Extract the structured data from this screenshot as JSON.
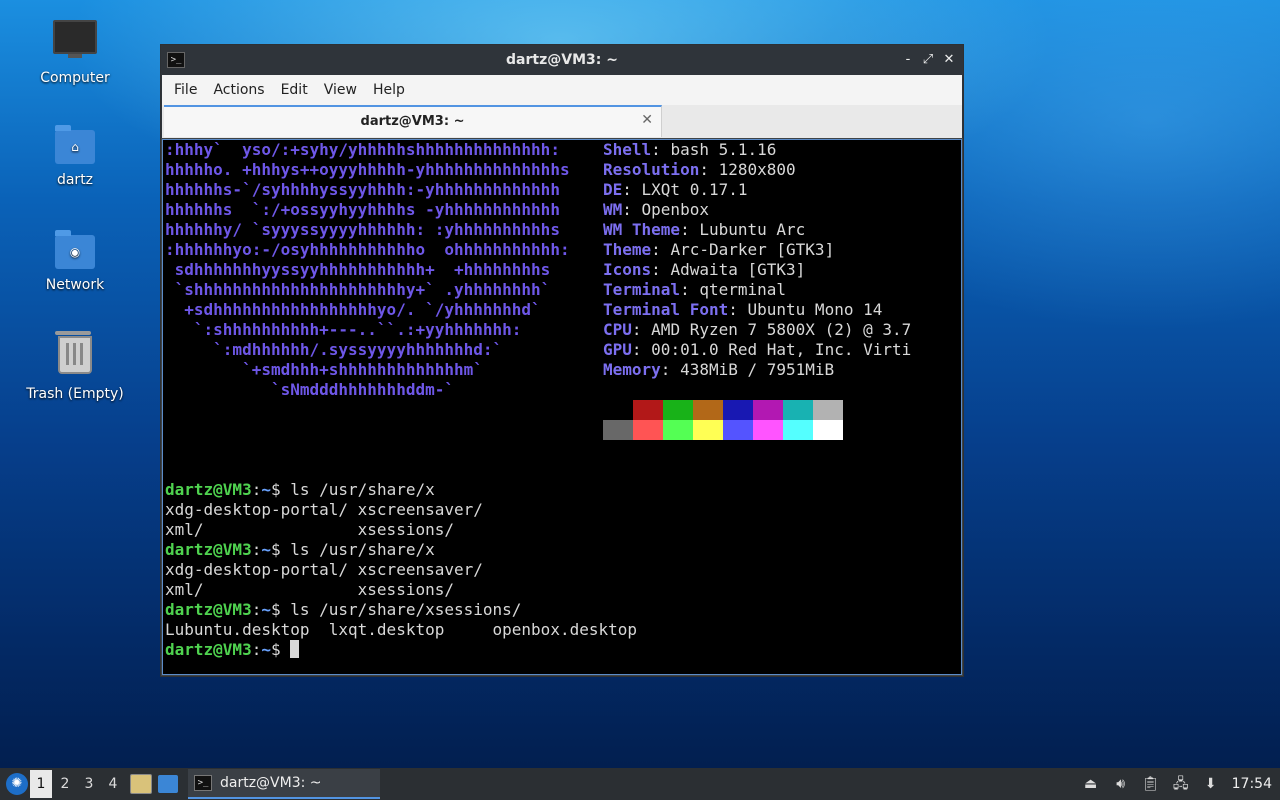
{
  "desktop": {
    "icons": [
      {
        "label": "Computer",
        "icon": "computer-icon"
      },
      {
        "label": "dartz",
        "icon": "home-folder-icon"
      },
      {
        "label": "Network",
        "icon": "network-folder-icon"
      },
      {
        "label": "Trash (Empty)",
        "icon": "trash-icon"
      }
    ]
  },
  "window": {
    "title": "dartz@VM3: ~",
    "menu": [
      "File",
      "Actions",
      "Edit",
      "View",
      "Help"
    ],
    "tab_title": "dartz@VM3: ~",
    "buttons": {
      "minimize": "‑",
      "maximize": "⤢",
      "close": "✕"
    }
  },
  "terminal": {
    "logo_lines": [
      ":hhhy`  yso/:+syhy/yhhhhhshhhhhhhhhhhhhh:",
      "hhhhho. +hhhys++oyyyhhhhh-yhhhhhhhhhhhhhhs",
      "hhhhhhs-`/syhhhhyssyyhhhh:-yhhhhhhhhhhhhh",
      "hhhhhhs  `:/+ossyyhyyhhhhs -yhhhhhhhhhhhh",
      "hhhhhhy/ `syyyssyyyyhhhhhh: :yhhhhhhhhhhs",
      ":hhhhhhyo:-/osyhhhhhhhhhhho  ohhhhhhhhhhh:",
      " sdhhhhhhhyyssyyhhhhhhhhhhh+  +hhhhhhhhs",
      " `shhhhhhhhhhhhhhhhhhhhhhy+` .yhhhhhhhh`",
      "  +sdhhhhhhhhhhhhhhhhhyo/. `/yhhhhhhhd`",
      "   `:shhhhhhhhhh+---..``.:+yyhhhhhhh:",
      "     `:mdhhhhhh/.syssyyyyhhhhhhhd:`",
      "        `+smdhhh+shhhhhhhhhhhhhm`",
      "           `sNmdddhhhhhhhddm-`"
    ],
    "info": [
      {
        "key": "Shell",
        "value": "bash 5.1.16"
      },
      {
        "key": "Resolution",
        "value": "1280x800"
      },
      {
        "key": "DE",
        "value": "LXQt 0.17.1"
      },
      {
        "key": "WM",
        "value": "Openbox"
      },
      {
        "key": "WM Theme",
        "value": "Lubuntu Arc"
      },
      {
        "key": "Theme",
        "value": "Arc-Darker [GTK3]"
      },
      {
        "key": "Icons",
        "value": "Adwaita [GTK3]"
      },
      {
        "key": "Terminal",
        "value": "qterminal"
      },
      {
        "key": "Terminal Font",
        "value": "Ubuntu Mono 14"
      },
      {
        "key": "CPU",
        "value": "AMD Ryzen 7 5800X (2) @ 3.7"
      },
      {
        "key": "GPU",
        "value": "00:01.0 Red Hat, Inc. Virti"
      },
      {
        "key": "Memory",
        "value": "438MiB / 7951MiB"
      }
    ],
    "palette_top": [
      "#000000",
      "#b21818",
      "#18b218",
      "#b26818",
      "#1818b2",
      "#b218b2",
      "#18b2b2",
      "#b2b2b2"
    ],
    "palette_bottom": [
      "#686868",
      "#ff5454",
      "#54ff54",
      "#ffff54",
      "#5454ff",
      "#ff54ff",
      "#54ffff",
      "#ffffff"
    ],
    "session": [
      {
        "type": "prompt",
        "user": "dartz@VM3",
        "path": "~",
        "cmd": "ls /usr/share/x"
      },
      {
        "type": "out",
        "text": "xdg-desktop-portal/ xscreensaver/"
      },
      {
        "type": "out",
        "text": "xml/                xsessions/"
      },
      {
        "type": "prompt",
        "user": "dartz@VM3",
        "path": "~",
        "cmd": "ls /usr/share/x"
      },
      {
        "type": "out",
        "text": "xdg-desktop-portal/ xscreensaver/"
      },
      {
        "type": "out",
        "text": "xml/                xsessions/"
      },
      {
        "type": "prompt",
        "user": "dartz@VM3",
        "path": "~",
        "cmd": "ls /usr/share/xsessions/"
      },
      {
        "type": "out",
        "text": "Lubuntu.desktop  lxqt.desktop     openbox.desktop"
      },
      {
        "type": "prompt",
        "user": "dartz@VM3",
        "path": "~",
        "cmd": ""
      }
    ]
  },
  "taskbar": {
    "workspaces": [
      "1",
      "2",
      "3",
      "4"
    ],
    "active_workspace": "1",
    "task_label": "dartz@VM3: ~",
    "clock": "17:54"
  }
}
